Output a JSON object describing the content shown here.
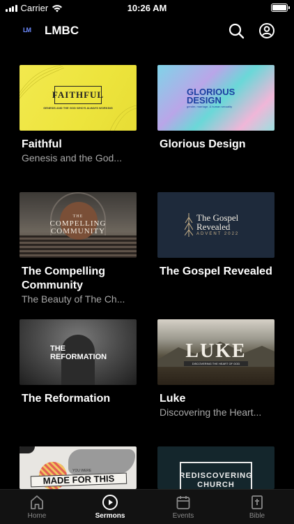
{
  "status_bar": {
    "carrier": "Carrier",
    "time": "10:26 AM"
  },
  "header": {
    "logo": "LM",
    "title": "LMBC"
  },
  "sermons": [
    {
      "title": "Faithful",
      "subtitle": "Genesis and the God...",
      "art_title": "FAITHFUL",
      "art_tagline": "GENESIS AND THE GOD WHO'S ALWAYS WORKING"
    },
    {
      "title": "Glorious Design",
      "subtitle": "",
      "art_title_1": "GLORIOUS",
      "art_title_2": "DESIGN",
      "art_tagline": "gender, marriage, & human sexuality"
    },
    {
      "title": "The Compelling Community",
      "subtitle": "The Beauty of The Ch...",
      "art_line_1": "THE",
      "art_line_2": "COMPELLING",
      "art_line_3": "COMMUNITY"
    },
    {
      "title": "The Gospel Revealed",
      "subtitle": "",
      "art_title_1": "The Gospel",
      "art_title_2": "Revealed",
      "art_tagline": "ADVENT 2022"
    },
    {
      "title": "The Reformation",
      "subtitle": "",
      "art_title_1": "THE",
      "art_title_2": "REFORMATION"
    },
    {
      "title": "Luke",
      "subtitle": "Discovering the Heart...",
      "art_title": "LUKE",
      "art_tagline": "DISCOVERING THE HEART OF GOD"
    },
    {
      "title": "",
      "subtitle": "",
      "art_small": "YOU WERE",
      "art_title": "MADE FOR THIS"
    },
    {
      "title": "",
      "subtitle": "",
      "art_title_1": "REDISCOVERING",
      "art_title_2": "CHURCH"
    }
  ],
  "tabs": [
    {
      "label": "Home",
      "icon": "home-icon",
      "active": false
    },
    {
      "label": "Sermons",
      "icon": "play-circle-icon",
      "active": true
    },
    {
      "label": "Events",
      "icon": "calendar-icon",
      "active": false
    },
    {
      "label": "Bible",
      "icon": "bible-icon",
      "active": false
    }
  ],
  "colors": {
    "background": "#000000",
    "tab_bar": "#121212",
    "subtitle": "#a8a8a8",
    "inactive_tab": "#8a8a8a"
  }
}
